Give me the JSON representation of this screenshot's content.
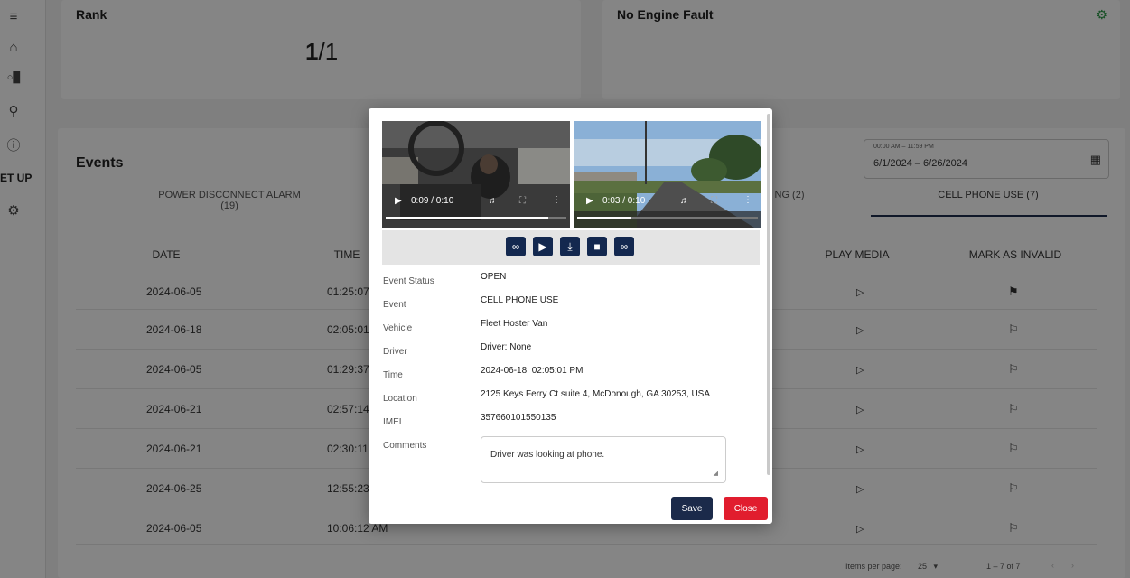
{
  "sidebar": {
    "icons": [
      "menu-icon",
      "home-icon",
      "signal-icon",
      "user-check-icon",
      "help-icon",
      "gear-icon"
    ],
    "setup_label": "SET UP"
  },
  "rank_card": {
    "title": "Rank",
    "value_bold": "1",
    "value_rest": "/1"
  },
  "engine_card": {
    "title": "No Engine Fault",
    "icon": "engine-icon",
    "icon_color": "#2e9a4a"
  },
  "events": {
    "title": "Events",
    "date_label": "00:00 AM – 11:59 PM",
    "date_range": "6/1/2024 – 6/26/2024",
    "tabs": [
      "POWER DISCONNECT ALARM (19)",
      "NG (2)",
      "CELL PHONE USE (7)"
    ],
    "columns": [
      "DATE",
      "TIME",
      "PLAY MEDIA",
      "MARK AS INVALID"
    ],
    "rows": [
      {
        "date": "2024-06-05",
        "time": "01:25:07"
      },
      {
        "date": "2024-06-18",
        "time": "02:05:01"
      },
      {
        "date": "2024-06-05",
        "time": "01:29:37"
      },
      {
        "date": "2024-06-21",
        "time": "02:57:14"
      },
      {
        "date": "2024-06-21",
        "time": "02:30:11"
      },
      {
        "date": "2024-06-25",
        "time": "12:55:23"
      },
      {
        "date": "2024-06-05",
        "time": "10:06:12 AM"
      }
    ],
    "pager": {
      "label": "Items per page:",
      "size": "25",
      "range": "1 – 7 of 7"
    }
  },
  "modal": {
    "video1": {
      "time": "0:09 / 0:10",
      "progress": 0.9
    },
    "video2": {
      "time": "0:03 / 0:10",
      "progress": 0.3
    },
    "toolbar_icons": [
      "link-icon",
      "play-icon",
      "download-icon",
      "stop-icon",
      "link-icon"
    ],
    "fields": [
      {
        "label": "Event Status",
        "value": "OPEN"
      },
      {
        "label": "Event",
        "value": "CELL PHONE USE"
      },
      {
        "label": "Vehicle",
        "value": "Fleet Hoster Van"
      },
      {
        "label": "Driver",
        "value": "Driver: None"
      },
      {
        "label": "Time",
        "value": "2024-06-18, 02:05:01 PM"
      },
      {
        "label": "Location",
        "value": "2125 Keys Ferry Ct suite 4, McDonough, GA 30253, USA"
      },
      {
        "label": "IMEI",
        "value": "357660101550135"
      },
      {
        "label": "Comments",
        "value": ""
      }
    ],
    "comment": "Driver was looking at phone.",
    "save_label": "Save",
    "close_label": "Close",
    "colors": {
      "primary": "#1b2a4a",
      "danger": "#e11d2e"
    }
  }
}
